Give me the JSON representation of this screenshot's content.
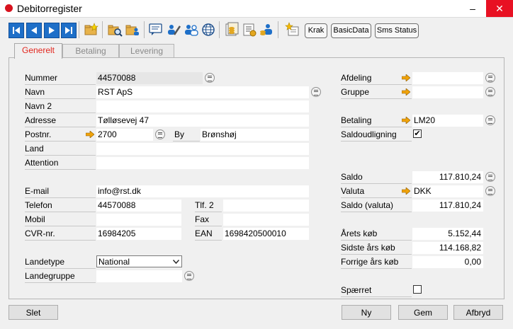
{
  "window": {
    "title": "Debitorregister"
  },
  "toolbar": {
    "krak": "Krak",
    "basicdata": "BasicData",
    "sms_status": "Sms Status"
  },
  "tabs": [
    "Generelt",
    "Betaling",
    "Levering"
  ],
  "left": {
    "nummer_label": "Nummer",
    "nummer": "44570088",
    "navn_label": "Navn",
    "navn": "RST ApS",
    "navn2_label": "Navn 2",
    "navn2": "",
    "adresse_label": "Adresse",
    "adresse": "Tølløsevej 47",
    "postnr_label": "Postnr.",
    "postnr": "2700",
    "by_label": "By",
    "by": "Brønshøj",
    "land_label": "Land",
    "land": "",
    "attention_label": "Attention",
    "attention": "",
    "email_label": "E-mail",
    "email": "info@rst.dk",
    "telefon_label": "Telefon",
    "telefon": "44570088",
    "tlf2_label": "Tlf. 2",
    "tlf2": "",
    "mobil_label": "Mobil",
    "mobil": "",
    "fax_label": "Fax",
    "fax": "",
    "cvr_label": "CVR-nr.",
    "cvr": "16984205",
    "ean_label": "EAN",
    "ean": "1698420500010",
    "landetype_label": "Landetype",
    "landetype": "National",
    "landegruppe_label": "Landegruppe",
    "landegruppe": ""
  },
  "right": {
    "afdeling_label": "Afdeling",
    "afdeling": "",
    "gruppe_label": "Gruppe",
    "gruppe": "",
    "betaling_label": "Betaling",
    "betaling": "LM20",
    "saldoudligning_label": "Saldoudligning",
    "saldoudligning_checked": "✔",
    "saldo_label": "Saldo",
    "saldo": "117.810,24",
    "valuta_label": "Valuta",
    "valuta": "DKK",
    "saldo_valuta_label": "Saldo (valuta)",
    "saldo_valuta": "117.810,24",
    "aarets_koeb_label": "Årets køb",
    "aarets_koeb": "5.152,44",
    "sidste_aars_koeb_label": "Sidste års køb",
    "sidste_aars_koeb": "114.168,82",
    "forrige_aars_koeb_label": "Forrige års køb",
    "forrige_aars_koeb": "0,00",
    "spaerret_label": "Spærret"
  },
  "buttons": {
    "slet": "Slet",
    "ny": "Ny",
    "gem": "Gem",
    "afbryd": "Afbryd"
  },
  "colors": {
    "accent": "#1e6fc8",
    "tab_active": "#e2261e",
    "close": "#e81123",
    "arrow": "#f0a30a"
  }
}
